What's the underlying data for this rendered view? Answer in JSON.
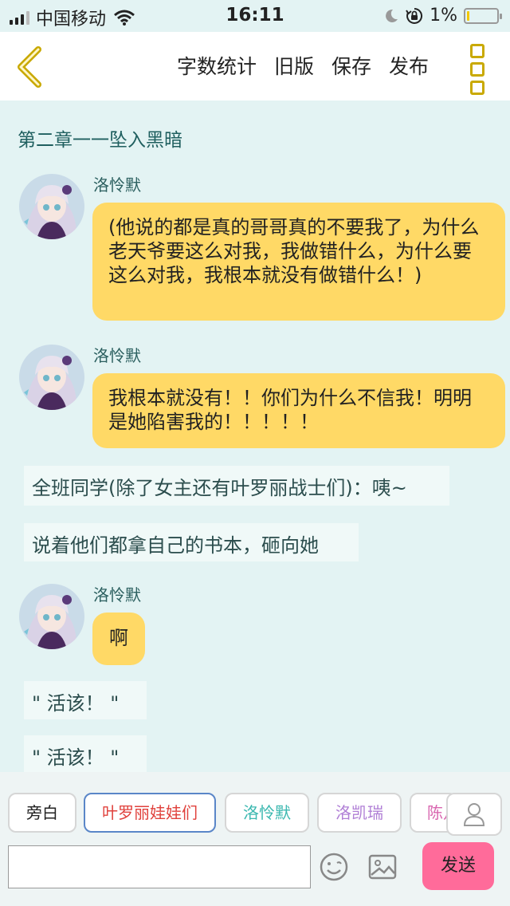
{
  "status_bar": {
    "carrier": "中国移动",
    "time": "16:11",
    "battery_percent": "1%",
    "battery_level": 0.05,
    "icons": [
      "signal-icon",
      "wifi-icon",
      "moon-icon",
      "orientation-lock-icon",
      "battery-icon"
    ]
  },
  "toolbar": {
    "word_count": "字数统计",
    "old_version": "旧版",
    "save": "保存",
    "publish": "发布",
    "back_icon": "chevron-left-icon",
    "menu_icon": "more-menu-icon",
    "accent_color": "#c9a900"
  },
  "chapter_title": "第二章一一坠入黑暗",
  "messages": [
    {
      "speaker": "洛怜默",
      "text": "(他说的都是真的哥哥真的不要我了，为什么老天爷要这么对我，我做错什么，为什么要这么对我，我根本就没有做错什么！)"
    },
    {
      "speaker": "洛怜默",
      "text": "我根本就没有！！你们为什么不信我！明明是她陷害我的！！！！！"
    },
    {
      "speaker": "洛怜默",
      "text": "啊"
    }
  ],
  "narrations": [
    "全班同学(除了女主还有叶罗丽战士们)：咦~",
    "说着他们都拿自己的书本，砸向她",
    "\" 活该！ \"",
    "\" 活该！ \""
  ],
  "characters": {
    "narrator": {
      "label": "旁白",
      "color": "#222222"
    },
    "group": {
      "label": "叶罗丽娃娃们",
      "color": "#e0413c"
    },
    "luolianmo": {
      "label": "洛怜默",
      "color": "#3bb8b0"
    },
    "luokairui": {
      "label": "洛凯瑞",
      "color": "#b07fd6"
    },
    "chen": {
      "label": "陈凡",
      "color": "#d966b0"
    }
  },
  "composer": {
    "input_value": "",
    "send_label": "发送",
    "send_color": "#ff6b9a",
    "bubble_color": "#ffd966"
  }
}
